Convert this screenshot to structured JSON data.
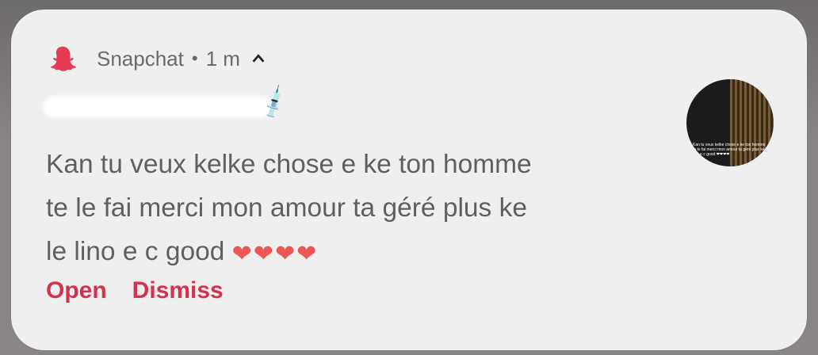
{
  "notification": {
    "app_name": "Snapchat",
    "separator": "•",
    "time": "1 m",
    "sender_emoji": "💉",
    "message_lines": [
      "Kan tu veux kelke chose e ke ton homme",
      "te le fai merci mon amour ta géré plus ke",
      "le lino e c good"
    ],
    "hearts": "❤❤❤❤",
    "actions": {
      "open": "Open",
      "dismiss": "Dismiss"
    },
    "thumbnail_caption": "Kan tu veux kelke chose e ke ton homme te le fai merci mon amour ta géré plus ke le lino e c good ❤❤❤❤"
  },
  "colors": {
    "accent": "#d4314e",
    "text": "#5f5f5f",
    "card_bg": "#efefef"
  },
  "icons": {
    "app": "snapchat-ghost-icon",
    "expand": "chevron-up-icon"
  }
}
